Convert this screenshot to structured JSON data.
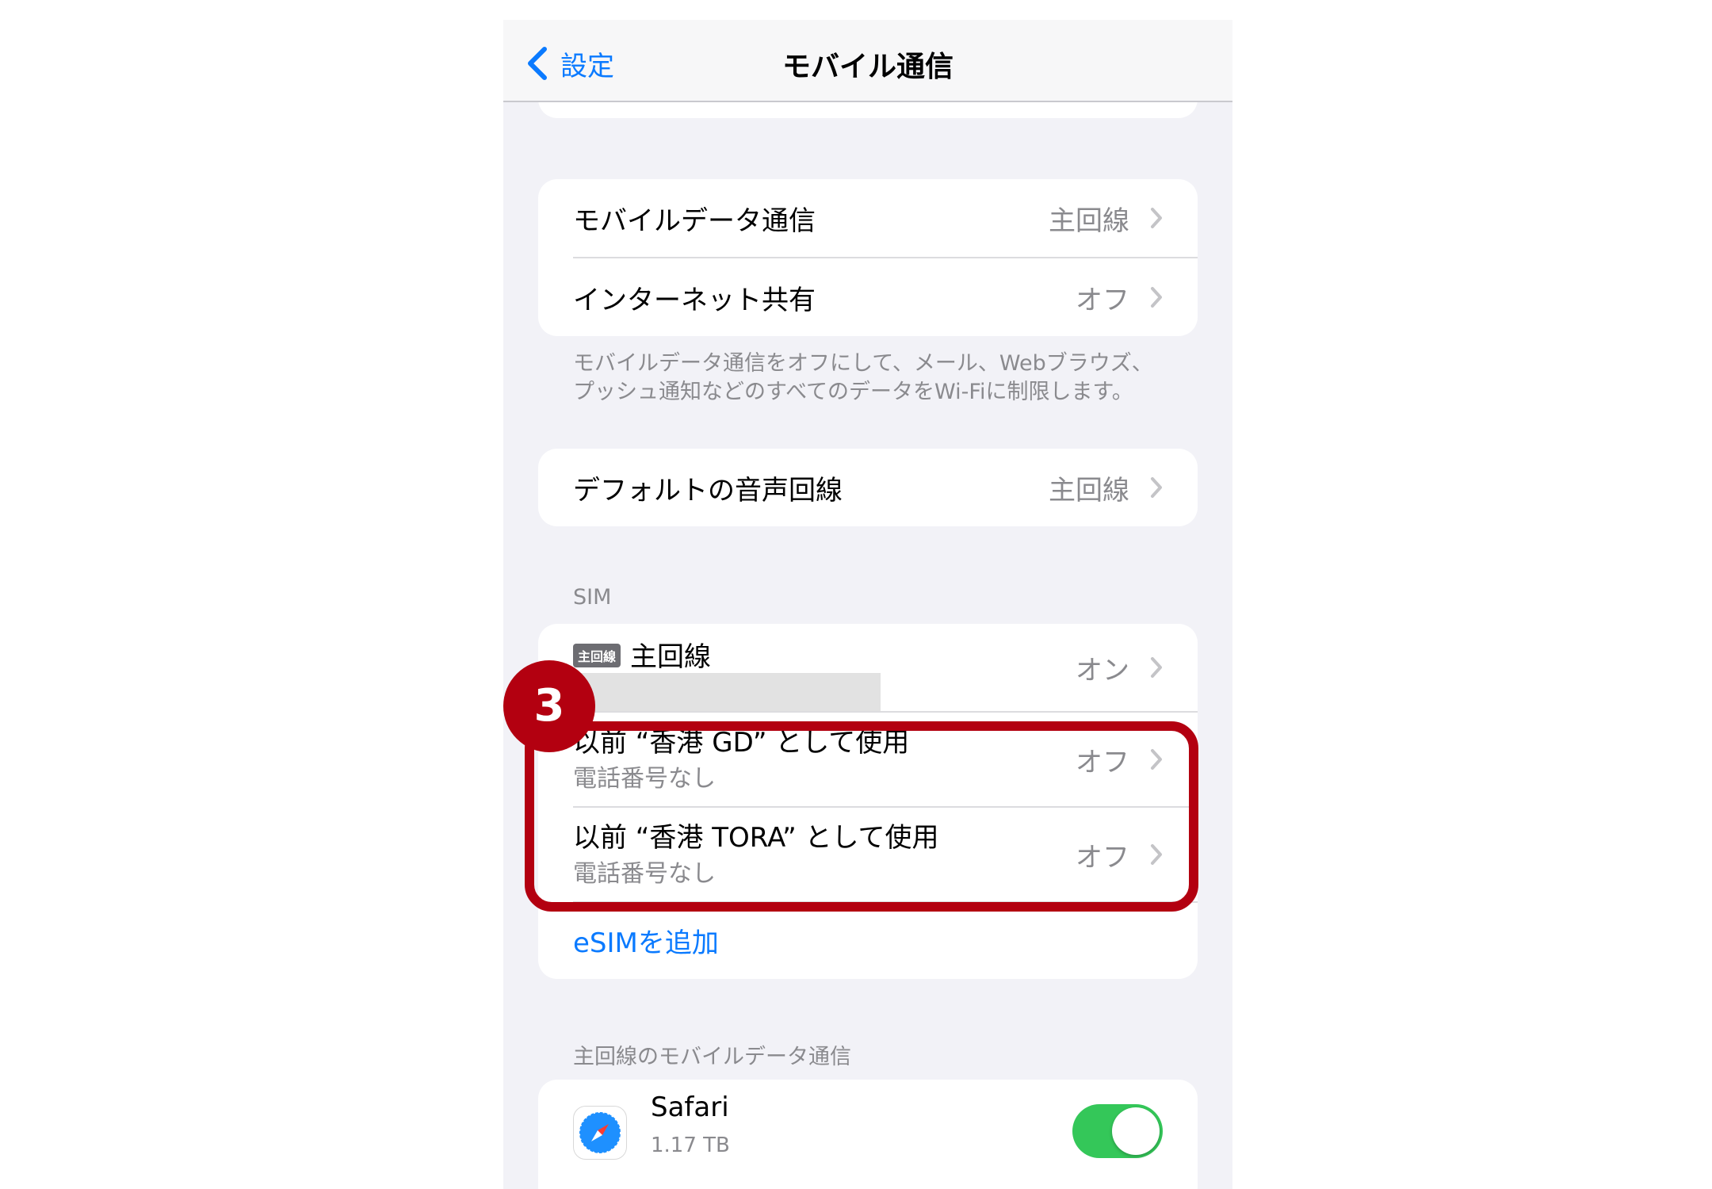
{
  "navbar": {
    "back_label": "設定",
    "title": "モバイル通信"
  },
  "group1": {
    "rows": [
      {
        "label": "モバイルデータ通信",
        "value": "主回線"
      },
      {
        "label": "インターネット共有",
        "value": "オフ"
      }
    ],
    "footnote_lines": [
      "モバイルデータ通信をオフにして、メール、Webブラウズ、",
      "プッシュ通知などのすべてのデータをWi-Fiに制限します。"
    ]
  },
  "group2": {
    "rows": [
      {
        "label": "デフォルトの音声回線",
        "value": "主回線"
      }
    ]
  },
  "sim_section": {
    "header": "SIM",
    "primary": {
      "badge": "主回線",
      "label": "主回線",
      "value": "オン"
    },
    "previous_lines": [
      {
        "label": "以前 “香港 GD” として使用",
        "sublabel": "電話番号なし",
        "value": "オフ"
      },
      {
        "label": "以前 “香港 TORA” として使用",
        "sublabel": "電話番号なし",
        "value": "オフ"
      }
    ],
    "add_esim": "eSIMを追加"
  },
  "cellular_data_section": {
    "header": "主回線のモバイルデータ通信",
    "apps": [
      {
        "name": "Safari",
        "usage": "1.17 TB",
        "enabled": true,
        "icon": "safari-compass-icon"
      }
    ]
  },
  "annotation": {
    "step_number": "3",
    "color": "#b30010"
  },
  "colors": {
    "accent": "#0a7aff",
    "toggle_on": "#34c759",
    "background": "#f2f2f7"
  }
}
